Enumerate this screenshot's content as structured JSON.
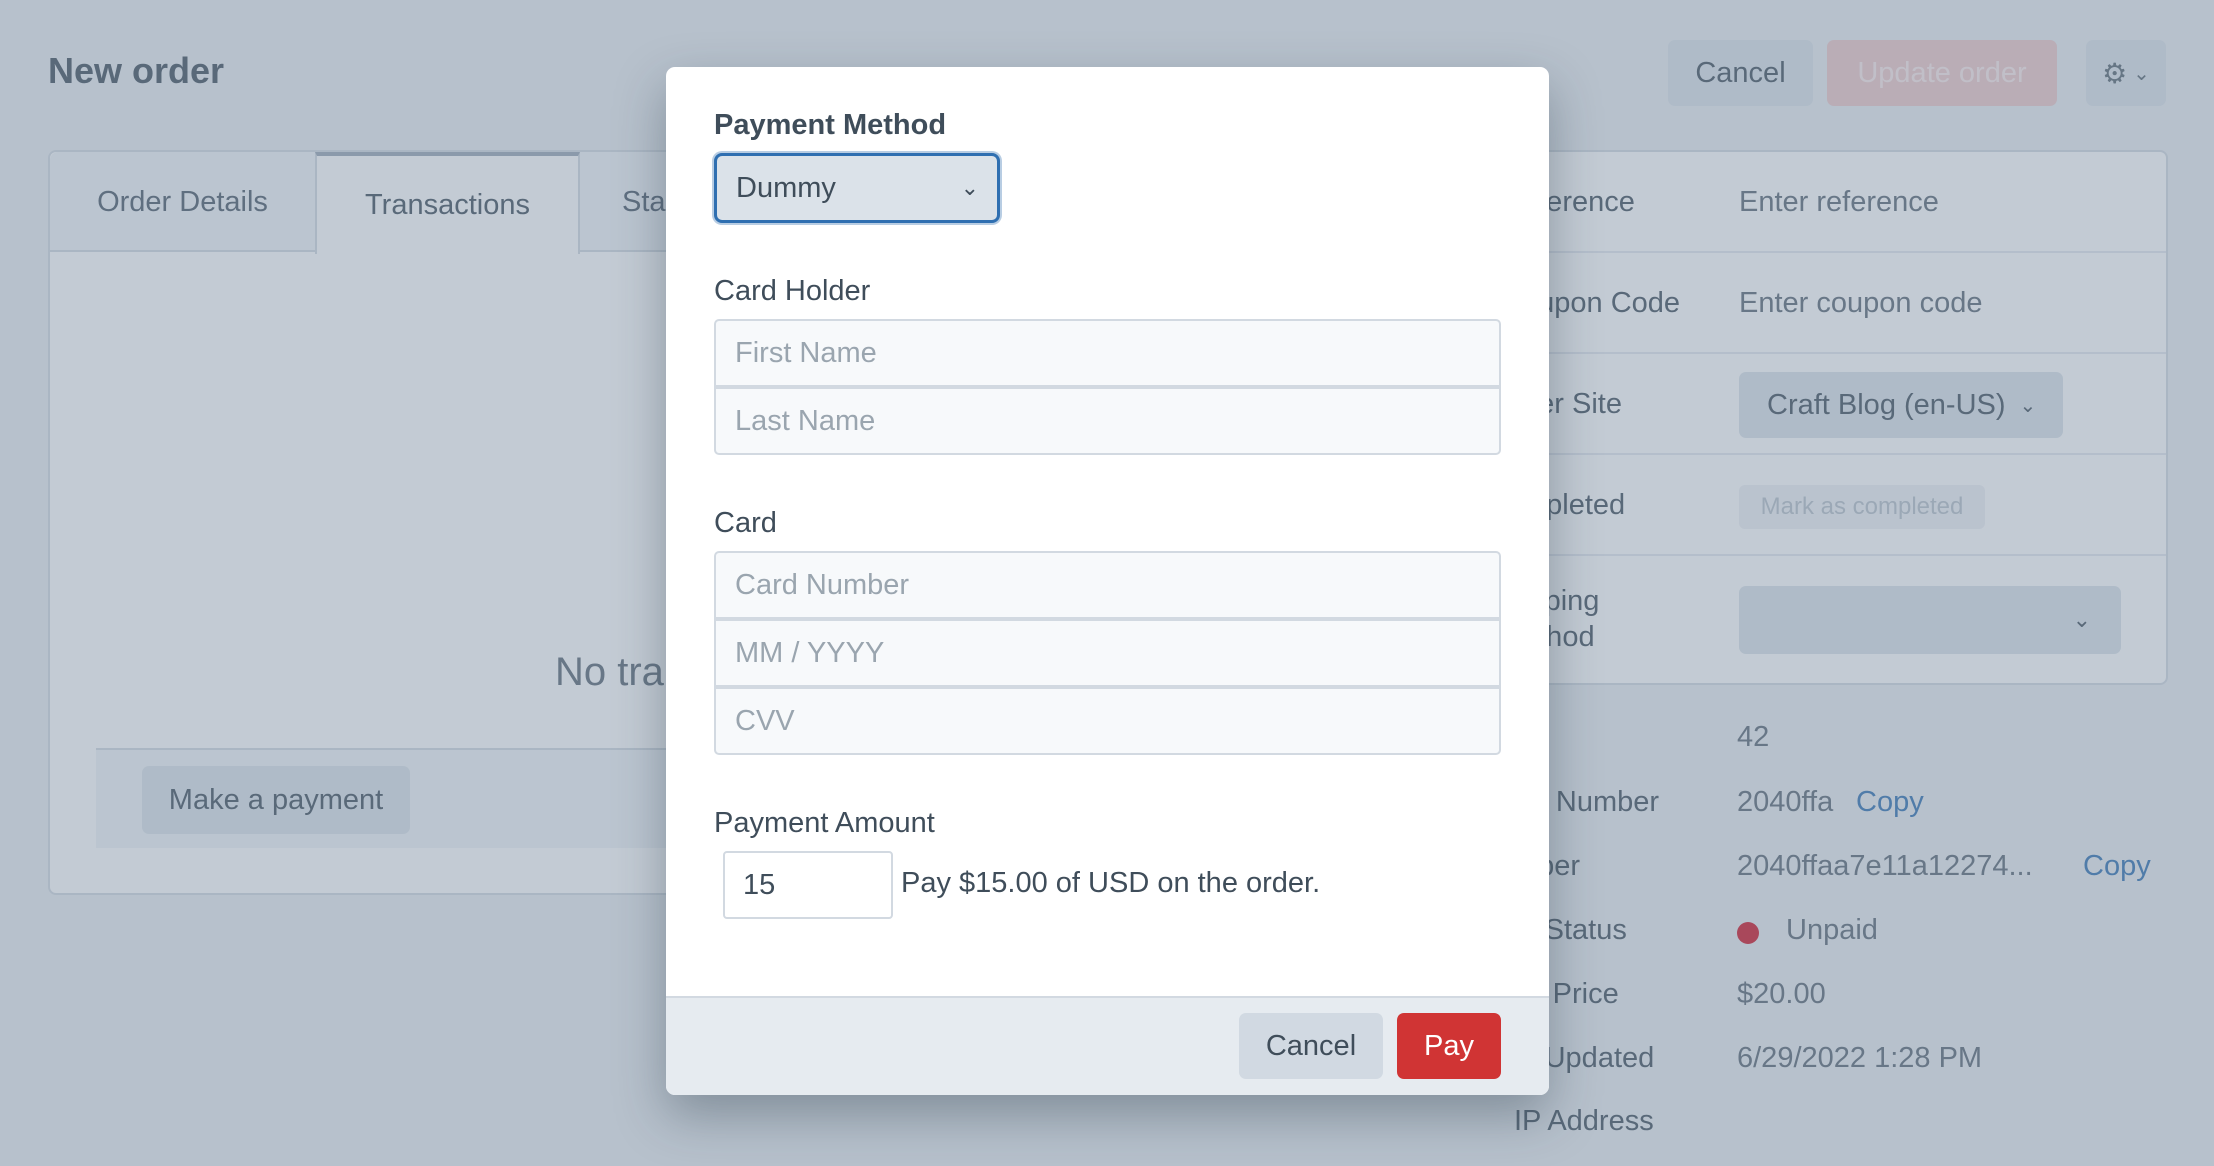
{
  "page": {
    "title": "New order",
    "cancel_label": "Cancel",
    "update_label": "Update order",
    "gear_icon": "gear-icon",
    "tabs": [
      "Order Details",
      "Transactions",
      "Sta"
    ],
    "empty_message": "No tra",
    "make_payment_label": "Make a payment"
  },
  "meta": {
    "reference_label": "eference",
    "reference_placeholder": "Enter reference",
    "coupon_label": "oupon Code",
    "coupon_placeholder": "Enter coupon code",
    "site_label": "der Site",
    "site_value": "Craft Blog (en-US)",
    "completed_label": "mpleted",
    "completed_button": "Mark as completed",
    "shipping_label_1": "ipping",
    "shipping_label_2": "ethod",
    "shipping_value": ""
  },
  "info": {
    "id_value": "42",
    "short_number_label": "ort Number",
    "short_number_value": "2040ffa",
    "number_label": "mber",
    "number_value": "2040ffaa7e11a12274...",
    "copy_label": "Copy",
    "paid_status_label": "id Status",
    "paid_status_value": "Unpaid",
    "total_label": "tal Price",
    "total_value": "$20.00",
    "updated_label": "st Updated",
    "updated_value": "6/29/2022 1:28 PM",
    "ip_label": "IP Address"
  },
  "modal": {
    "payment_method_label": "Payment Method",
    "payment_method_value": "Dummy",
    "card_holder_label": "Card Holder",
    "first_name_placeholder": "First Name",
    "last_name_placeholder": "Last Name",
    "card_label": "Card",
    "card_number_placeholder": "Card Number",
    "expiry_placeholder": "MM / YYYY",
    "cvv_placeholder": "CVV",
    "amount_label": "Payment Amount",
    "amount_value": "15",
    "amount_note": "Pay $15.00 of USD on the order.",
    "cancel_label": "Cancel",
    "pay_label": "Pay"
  },
  "colors": {
    "accent": "#2f6fb1",
    "pay_button": "#d03434",
    "unpaid_dot": "#cf1124"
  }
}
